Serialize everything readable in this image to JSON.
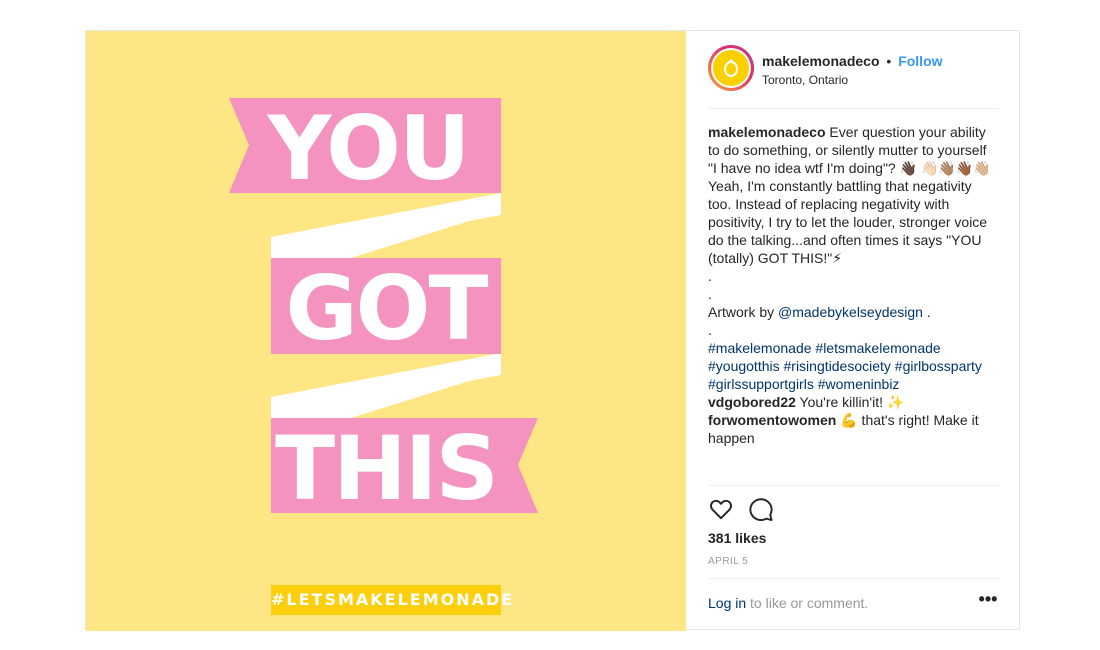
{
  "artwork": {
    "lines": [
      "YOU",
      "GOT",
      "THIS"
    ],
    "hashtag": "#LETSMAKELEMONADE",
    "colors": {
      "background": "#fee685",
      "ribbon": "#f493bf",
      "ribbon_fold": "#ffffff",
      "hashtag_bar": "#fbcf0c"
    }
  },
  "header": {
    "username": "makelemonadeco",
    "separator": "•",
    "follow_label": "Follow",
    "location": "Toronto, Ontario"
  },
  "caption": {
    "username": "makelemonadeco",
    "text_1": "Ever question your ability to do something, or silently mutter to yourself \"I have no idea wtf I'm doing\"? 👋🏿",
    "text_2": "👋🏻👋🏽👋🏾👋🏼Yeah, I'm constantly battling that negativity too. Instead of replacing negativity with positivity, I try to let the louder, stronger voice do the talking...and often times it says \"YOU (totally) GOT THIS!\"⚡",
    "dot_1": ".",
    "dot_2": ".",
    "artwork_label": "Artwork by",
    "artwork_handle": "@madebykelseydesign",
    "artwork_end": ".",
    "dot_3": ".",
    "hashtags": [
      "#makelemonade",
      "#letsmakelemonade",
      "#yougotthis",
      "#risingtidesociety",
      "#girlbossparty",
      "#girlssupportgirls",
      "#womeninbiz"
    ]
  },
  "comments": [
    {
      "username": "vdgobored22",
      "text": "You're killin'it! ✨"
    },
    {
      "username": "forwomentowomen",
      "text": "💪 that's right! Make it happen"
    }
  ],
  "actions": {
    "like_icon": "heart-icon",
    "comment_icon": "speech-bubble-icon",
    "likes": "381 likes",
    "date": "APRIL 5",
    "login_link": "Log in",
    "login_rest": "to like or comment.",
    "more_label": "•••"
  }
}
